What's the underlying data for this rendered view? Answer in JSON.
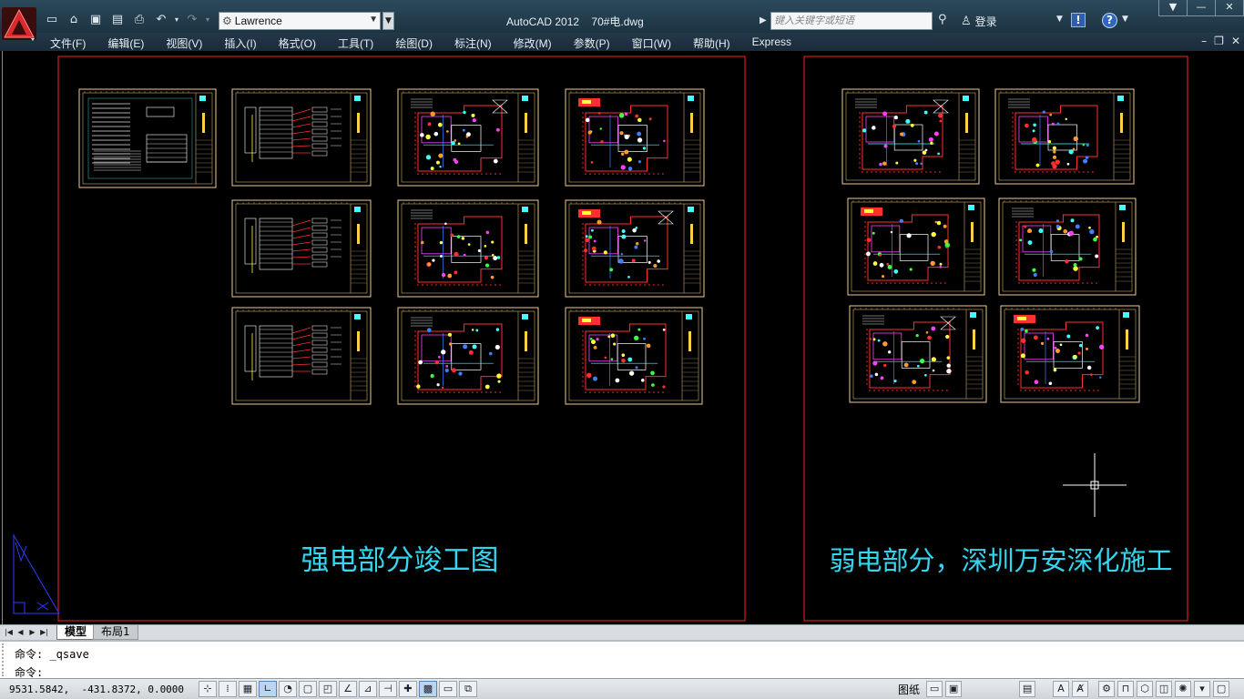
{
  "app": {
    "title_app": "AutoCAD 2012",
    "title_file": "70#电.dwg",
    "workspace": "Lawrence",
    "search_placeholder": "键入关键字或短语",
    "login_label": "登录"
  },
  "menus": [
    "文件(F)",
    "编辑(E)",
    "视图(V)",
    "插入(I)",
    "格式(O)",
    "工具(T)",
    "绘图(D)",
    "标注(N)",
    "修改(M)",
    "参数(P)",
    "窗口(W)",
    "帮助(H)",
    "Express"
  ],
  "drawing": {
    "left_caption": "强电部分竣工图",
    "right_caption": "弱电部分，深圳万安深化施工",
    "colors": {
      "frame": "#ff2020",
      "sheet_border": "#f0c890",
      "caption": "#33d6ee",
      "cursor": "#ffffff"
    }
  },
  "tabs": {
    "model": "模型",
    "layout1": "布局1"
  },
  "command": {
    "line1": "命令: _qsave",
    "line2": "命令:"
  },
  "status": {
    "coords": "9531.5842,  -431.8372, 0.0000",
    "paper": "图纸"
  }
}
